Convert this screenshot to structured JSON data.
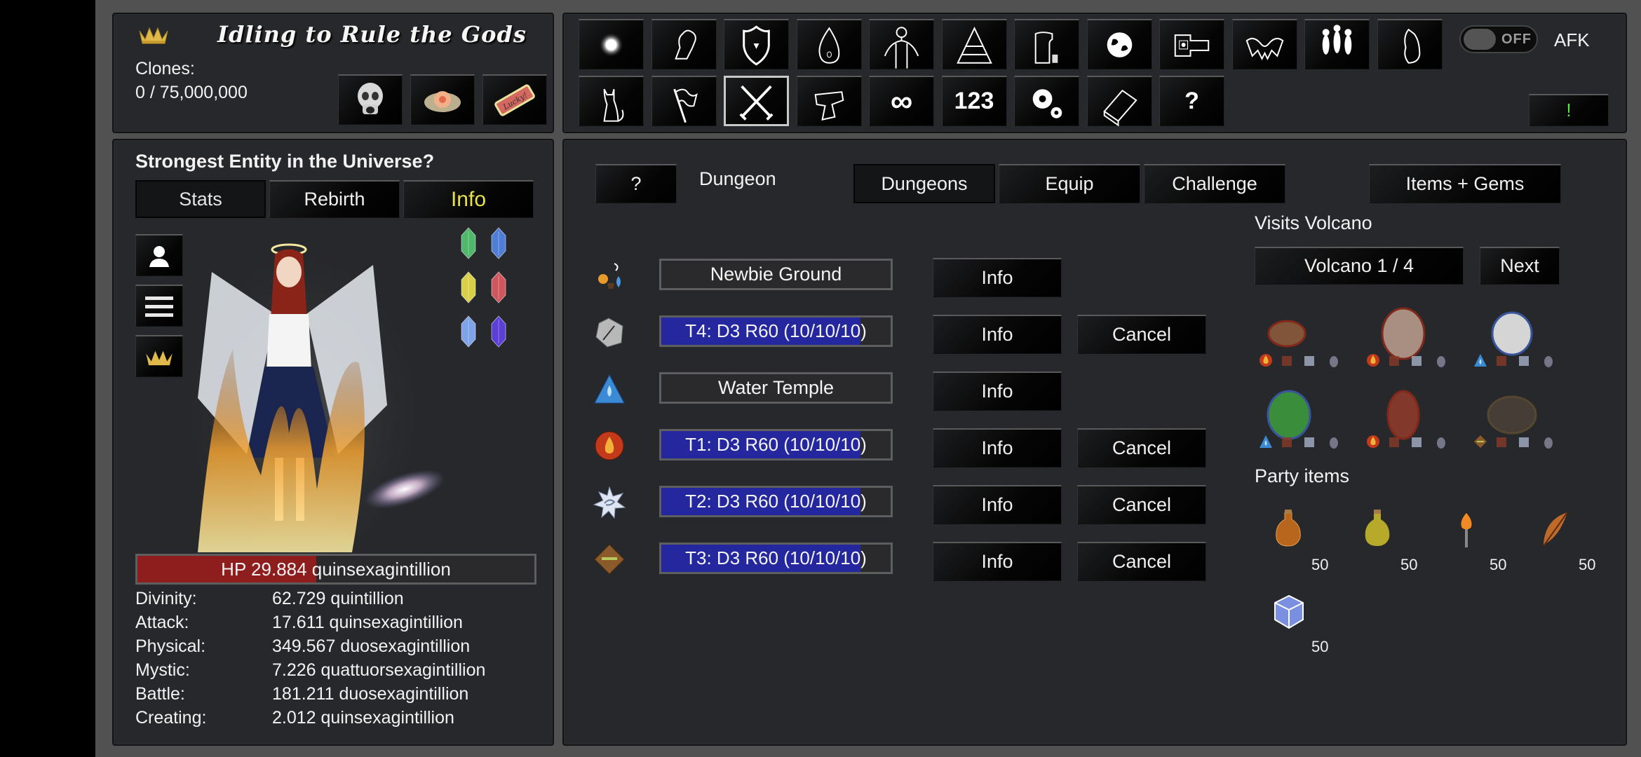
{
  "app": {
    "title": "Idling to Rule the Gods",
    "clones_label": "Clones:",
    "clones_value": "0 / 75,000,000",
    "header_icons": [
      "skull-icon",
      "flower-icon",
      "lucky-ticket-icon"
    ],
    "lucky_text": "Lucky!"
  },
  "nav": {
    "row1": [
      {
        "name": "light-orb-icon"
      },
      {
        "name": "fist-icon"
      },
      {
        "name": "shield-icon"
      },
      {
        "name": "slime-icon"
      },
      {
        "name": "human-figure-icon"
      },
      {
        "name": "pyramid-icon"
      },
      {
        "name": "factory-icon"
      },
      {
        "name": "planet-icon"
      },
      {
        "name": "spaceship-icon"
      },
      {
        "name": "monster-wings-icon"
      },
      {
        "name": "gods-group-icon"
      },
      {
        "name": "bird-icon"
      }
    ],
    "row2": [
      {
        "name": "cat-icon"
      },
      {
        "name": "flag-icon"
      },
      {
        "name": "crossed-swords-icon",
        "selected": true
      },
      {
        "name": "anvil-icon"
      },
      {
        "name": "infinity-icon",
        "text": "∞"
      },
      {
        "name": "numbers-icon",
        "text": "123"
      },
      {
        "name": "gears-icon"
      },
      {
        "name": "book-icon"
      },
      {
        "name": "question-icon",
        "text": "?"
      }
    ],
    "afk_toggle": {
      "state": "OFF",
      "label": "AFK"
    },
    "alert_button": "!"
  },
  "character": {
    "title": "Strongest Entity in the Universe?",
    "tabs": [
      {
        "label": "Stats",
        "active": true
      },
      {
        "label": "Rebirth",
        "active": false
      },
      {
        "label": "Info",
        "active": false,
        "color": "#e8e247"
      }
    ],
    "side_buttons": [
      "profile-icon",
      "menu-icon",
      "crown-icon"
    ],
    "gems": [
      {
        "name": "green-crystal",
        "color": "#4fb86a"
      },
      {
        "name": "blue-crystal",
        "color": "#4f7ed6"
      },
      {
        "name": "yellow-crystal",
        "color": "#d9d04a"
      },
      {
        "name": "red-crystal",
        "color": "#d0565e"
      },
      {
        "name": "light-blue-crystal",
        "color": "#7fa3e8"
      },
      {
        "name": "purple-crystal",
        "color": "#5c3fd6"
      }
    ],
    "hp": {
      "label": "HP 29.884 quinsexagintillion",
      "fraction": 0.45,
      "color": "#8e1d1d"
    },
    "stats": [
      {
        "name": "Divinity:",
        "value": "62.729 quintillion"
      },
      {
        "name": "Attack:",
        "value": "17.611 quinsexagintillion"
      },
      {
        "name": "Physical:",
        "value": "349.567 duosexagintillion"
      },
      {
        "name": "Mystic:",
        "value": "7.226 quattuorsexagintillion"
      },
      {
        "name": "Battle:",
        "value": "181.211 duosexagintillion"
      },
      {
        "name": "Creating:",
        "value": "2.012 quinsexagintillion"
      }
    ]
  },
  "dungeon": {
    "help_button": "?",
    "title": "Dungeon",
    "tabs": [
      {
        "label": "Dungeons",
        "active": true
      },
      {
        "label": "Equip",
        "active": false
      },
      {
        "label": "Challenge",
        "active": false
      }
    ],
    "items_gems_button": "Items + Gems",
    "rows": [
      {
        "icon": "newbie-ground-icon",
        "label": "Newbie Ground",
        "progress": null,
        "info": "Info",
        "cancel": null
      },
      {
        "icon": "neutral-rock-icon",
        "label": "T4: D3 R60 (10/10/10)",
        "progress": 0.87,
        "info": "Info",
        "cancel": "Cancel"
      },
      {
        "icon": "water-element-icon",
        "label": "Water Temple",
        "progress": null,
        "info": "Info",
        "cancel": null
      },
      {
        "icon": "fire-element-icon",
        "label": "T1: D3 R60 (10/10/10)",
        "progress": 0.87,
        "info": "Info",
        "cancel": "Cancel"
      },
      {
        "icon": "wind-element-icon",
        "label": "T2: D3 R60 (10/10/10)",
        "progress": 0.87,
        "info": "Info",
        "cancel": "Cancel"
      },
      {
        "icon": "earth-element-icon",
        "label": "T3: D3 R60 (10/10/10)",
        "progress": 0.87,
        "info": "Info",
        "cancel": "Cancel"
      }
    ],
    "visits": {
      "title": "Visits Volcano",
      "selector": "Volcano 1 / 4",
      "next_button": "Next",
      "monsters": [
        {
          "name": "fire-squirrel",
          "color": "#8b5a3c",
          "element": "fire"
        },
        {
          "name": "fire-elephant",
          "color": "#b89a8c",
          "element": "fire"
        },
        {
          "name": "water-penguin",
          "color": "#e8e8e8",
          "element": "water"
        },
        {
          "name": "water-tree-spirit",
          "color": "#3d9a3d",
          "element": "water"
        },
        {
          "name": "fire-santa-girl",
          "color": "#8c3a2a",
          "element": "fire"
        },
        {
          "name": "earth-rabbit",
          "color": "#4a4038",
          "element": "earth"
        }
      ]
    },
    "party": {
      "title": "Party items",
      "items": [
        {
          "name": "orange-potion",
          "count": "50",
          "color": "#b8651e"
        },
        {
          "name": "yellow-potion",
          "count": "50",
          "color": "#b7a92a"
        },
        {
          "name": "torch",
          "count": "50",
          "color": "#f08a24"
        },
        {
          "name": "feather",
          "count": "50",
          "color": "#c06a2a"
        },
        {
          "name": "ice-cube",
          "count": "50",
          "color": "#7b8fe0"
        }
      ]
    }
  }
}
